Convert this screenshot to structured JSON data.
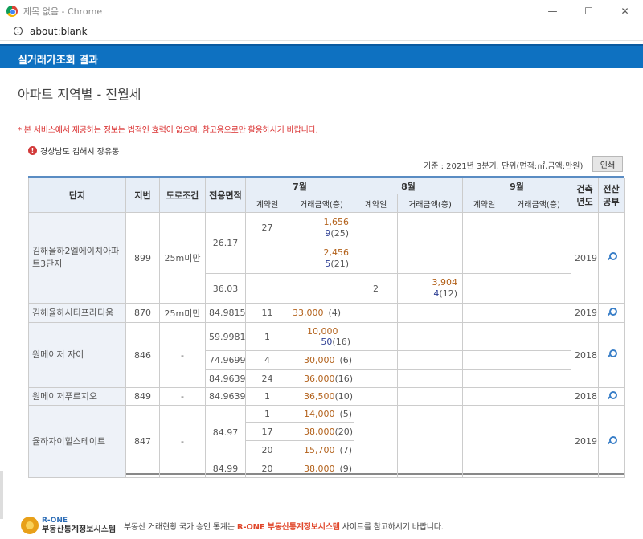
{
  "window": {
    "title": "제목 없음 - Chrome",
    "minimize": "—",
    "maximize": "☐",
    "close": "✕"
  },
  "address": {
    "url": "about:blank"
  },
  "header": {
    "title": "실거래가조회 결과"
  },
  "page": {
    "heading": "아파트 지역별 - 전월세"
  },
  "notice": "* 본 서비스에서 제공하는 정보는 법적인 효력이 없으며, 참고용으로만 활용하시기 바랍니다.",
  "location": "경상남도 김해시 장유동",
  "criteria": "기준 : 2021년 3분기, 단위(면적:㎡,금액:만원)",
  "print_label": "인쇄",
  "table": {
    "headers": {
      "complex": "단지",
      "lot": "지번",
      "road": "도로조건",
      "area": "전용면적",
      "m7": "7월",
      "m8": "8월",
      "m9": "9월",
      "built": "건축년도",
      "record": "전산공부",
      "contract_day": "계약일",
      "amount": "거래금액(층)"
    },
    "rows": {
      "r1": {
        "name": "김해율하2엘에이치아파트3단지",
        "lot": "899",
        "road": "25m미만",
        "built": "2019",
        "a1": "26.17",
        "d1": "27",
        "p1a": "1,656",
        "p1b": "9",
        "f1": "(25)",
        "p2a": "2,456",
        "p2b": "5",
        "f2": "(21)",
        "a2": "36.03",
        "d2": "2",
        "p3a": "3,904",
        "p3b": "4",
        "f3": "(12)"
      },
      "r2": {
        "name": "김해율하시티프라디움",
        "lot": "870",
        "road": "25m미만",
        "area": "84.9815",
        "day": "11",
        "amt": "33,000",
        "floor": "(4)",
        "built": "2019"
      },
      "r3": {
        "name": "원메이저 자이",
        "lot": "846",
        "road": "-",
        "built": "2018",
        "a1": "59.9981",
        "d1": "1",
        "p1a": "10,000",
        "p1b": "50",
        "f1": "(16)",
        "a2": "74.9699",
        "d2": "4",
        "p2": "30,000",
        "f2": "(6)",
        "a3": "84.9639",
        "d3": "24",
        "p3": "36,000",
        "f3": "(16)"
      },
      "r4": {
        "name": "원메이저푸르지오",
        "lot": "849",
        "road": "-",
        "area": "84.9639",
        "day": "1",
        "amt": "36,500",
        "floor": "(10)",
        "built": "2018"
      },
      "r5": {
        "name": "율하자이힐스테이트",
        "lot": "847",
        "road": "-",
        "built": "2019",
        "a1": "84.97",
        "a2": "84.99",
        "d1": "1",
        "p1": "14,000",
        "f1": "(5)",
        "d2": "17",
        "p2": "38,000",
        "f2": "(20)",
        "d3": "20",
        "p3": "15,700",
        "f3": "(7)",
        "d4": "20",
        "p4": "38,000",
        "f4": "(9)"
      }
    }
  },
  "footer": {
    "logo_top": "R-ONE",
    "logo_bottom": "부동산통계정보시스템",
    "msg_a": "부동산 거래현황 국가 승인 통계는",
    "msg_hl": "R-ONE 부동산통계정보시스템",
    "msg_b": "사이트를 참고하시기 바랍니다."
  },
  "colors": {
    "header_bar": "#0e71c1",
    "amount": "#b3621c",
    "count": "#2d3e93",
    "notice": "#d92b2b"
  }
}
